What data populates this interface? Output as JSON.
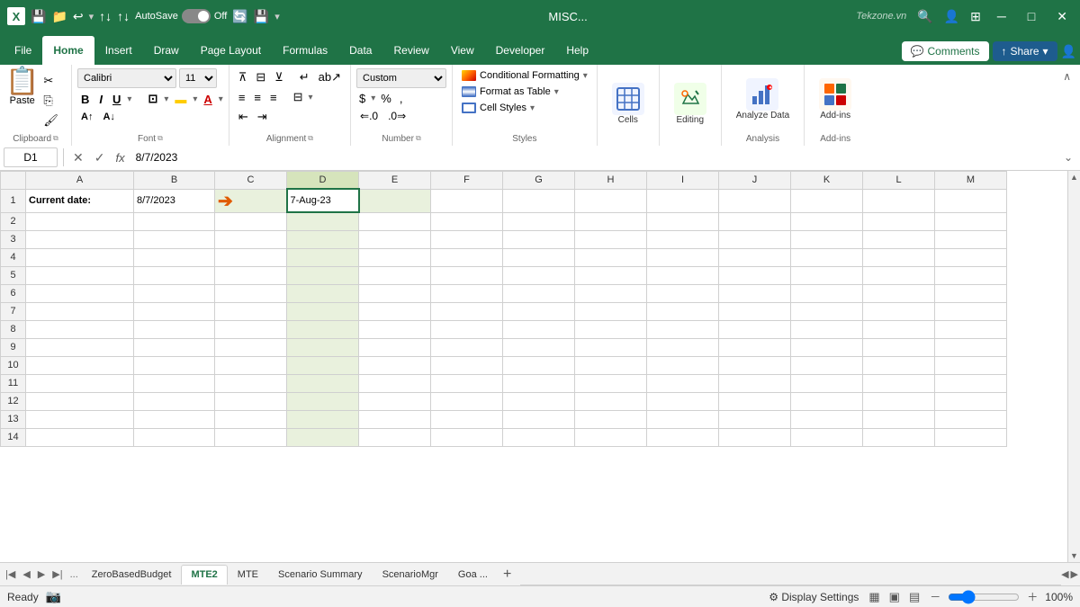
{
  "titlebar": {
    "filename": "MISC...",
    "app": "Excel",
    "autosave_label": "AutoSave",
    "autosave_state": "Off",
    "search_placeholder": "Search",
    "minimize": "─",
    "restore": "□",
    "close": "✕",
    "watermark": "Tekzone.vn"
  },
  "tabs": {
    "items": [
      "File",
      "Home",
      "Insert",
      "Draw",
      "Page Layout",
      "Formulas",
      "Data",
      "Review",
      "View",
      "Developer",
      "Help"
    ],
    "active": "Home"
  },
  "ribbon_right": {
    "comments_label": "Comments",
    "share_label": "Share"
  },
  "ribbon": {
    "groups": {
      "clipboard": {
        "label": "Clipboard",
        "paste_label": "Paste"
      },
      "font": {
        "label": "Font",
        "font_name": "Calibri",
        "font_size": "11"
      },
      "alignment": {
        "label": "Alignment"
      },
      "number": {
        "label": "Number",
        "format": "Custom"
      },
      "styles": {
        "label": "Styles",
        "conditional_formatting": "Conditional Formatting",
        "format_as_table": "Format as Table",
        "cell_styles": "Cell Styles"
      },
      "cells": {
        "label": "Cells"
      },
      "editing": {
        "label": "Editing"
      },
      "analysis": {
        "label": "Analysis",
        "analyze_data": "Analyze Data"
      },
      "addins": {
        "label": "Add-ins",
        "add_ins": "Add-ins"
      }
    }
  },
  "formulabar": {
    "cell_ref": "D1",
    "formula": "8/7/2023",
    "cancel_label": "✕",
    "confirm_label": "✓",
    "fx_label": "fx"
  },
  "spreadsheet": {
    "columns": [
      "A",
      "B",
      "C",
      "D",
      "E",
      "F",
      "G",
      "H",
      "I",
      "J",
      "K",
      "L",
      "M"
    ],
    "rows": 14,
    "cells": {
      "A1": "Current date:",
      "B1": "8/7/2023",
      "D1": "7-Aug-23"
    },
    "active_cell": "D1",
    "selected_col": "D"
  },
  "sheet_tabs": {
    "tabs": [
      "ZeroBasedBudget",
      "MTE2",
      "MTE",
      "Scenario Summary",
      "ScenarioMgr",
      "Goa ..."
    ],
    "active": "MTE2"
  },
  "statusbar": {
    "status": "Ready",
    "view_normal": "▦",
    "view_layout": "▣",
    "view_pagebreak": "▤",
    "zoom_level": "100%"
  }
}
